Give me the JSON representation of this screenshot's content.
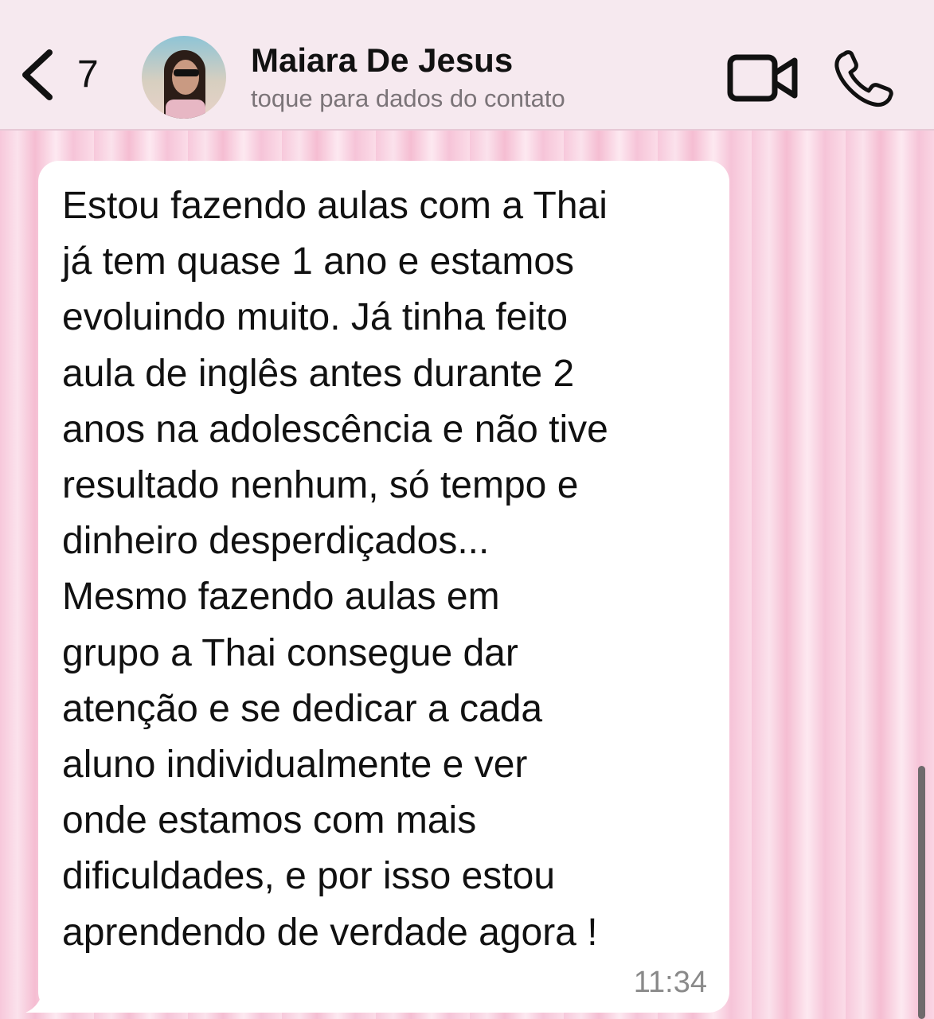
{
  "header": {
    "back_count": "7",
    "contact_name": "Maiara De Jesus",
    "contact_subtitle": "toque para dados do contato",
    "icons": {
      "back": "chevron-left-icon",
      "video": "video-camera-icon",
      "call": "phone-icon"
    }
  },
  "message": {
    "text": "Estou fazendo aulas com a Thai\njá tem quase 1 ano e estamos\nevoluindo muito. Já tinha feito\naula de inglês antes durante 2\nanos na adolescência e não tive\nresultado nenhum,  só tempo e\ndinheiro desperdiçados...\nMesmo fazendo aulas em\ngrupo a Thai consegue dar\natenção e se dedicar a cada\naluno individualmente e ver\nonde estamos com mais\ndificuldades, e por isso estou\naprendendo de verdade agora !",
    "time": "11:34"
  },
  "colors": {
    "header_bg": "#f6e9ef",
    "bubble_bg": "#ffffff",
    "wallpaper_pink": "#f7c8db"
  }
}
